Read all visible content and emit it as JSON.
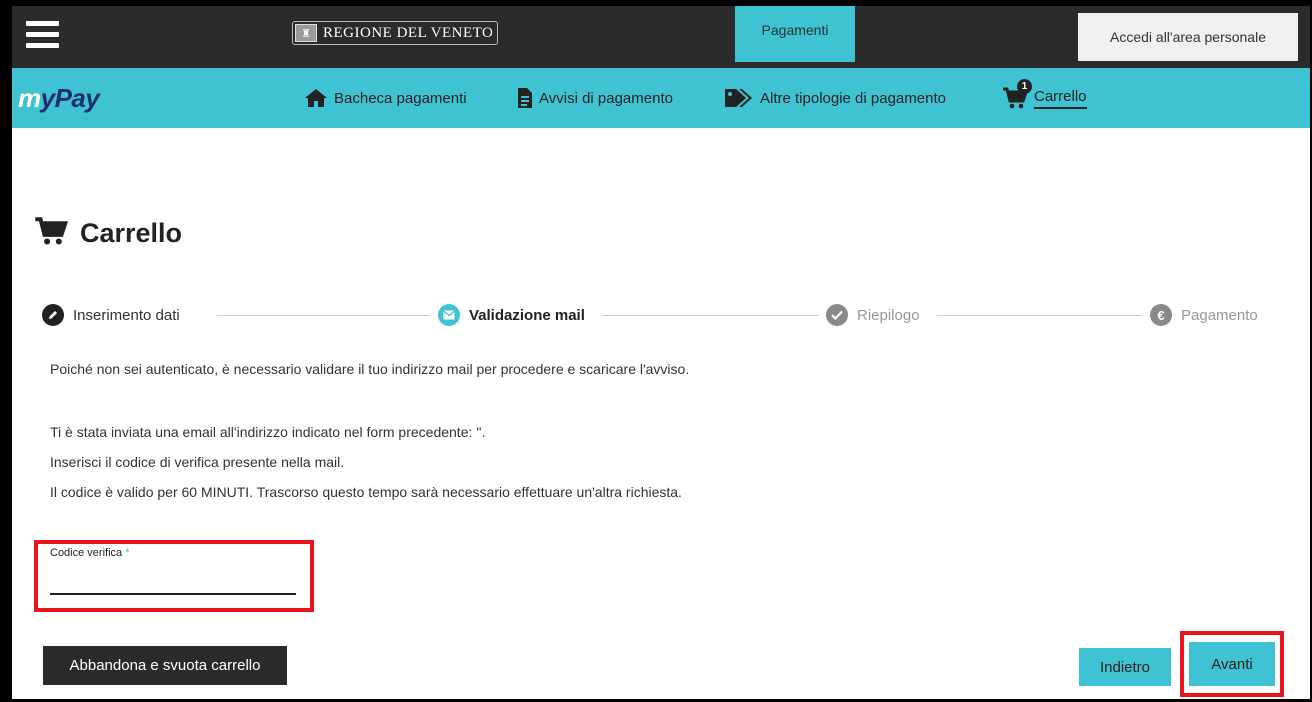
{
  "header": {
    "region_logo_text": "REGIONE DEL VENETO",
    "tab_pagamenti": "Pagamenti",
    "login_button": "Accedi all'area personale"
  },
  "nav": {
    "logo": "myPay",
    "items": [
      {
        "label": "Bacheca pagamenti",
        "icon": "home-icon"
      },
      {
        "label": "Avvisi di pagamento",
        "icon": "document-icon"
      },
      {
        "label": "Altre tipologie di pagamento",
        "icon": "tags-icon"
      },
      {
        "label": "Carrello",
        "icon": "cart-icon",
        "badge": "1",
        "active": true
      }
    ]
  },
  "page": {
    "title": "Carrello"
  },
  "stepper": {
    "steps": [
      {
        "label": "Inserimento dati",
        "icon": "pencil-icon",
        "state": "done"
      },
      {
        "label": "Validazione mail",
        "icon": "envelope-icon",
        "state": "active"
      },
      {
        "label": "Riepilogo",
        "icon": "check-icon",
        "state": "pending"
      },
      {
        "label": "Pagamento",
        "icon": "euro-icon",
        "state": "pending"
      }
    ]
  },
  "content": {
    "intro": "Poiché non sei autenticato, è necessario validare il tuo indirizzo mail per procedere e scaricare l'avviso.",
    "line1": "Ti è stata inviata una email all'indirizzo indicato nel form precedente: ''.",
    "line2": "Inserisci il codice di verifica presente nella mail.",
    "line3": "Il codice è valido per 60 MINUTI. Trascorso questo tempo sarà necessario effettuare un'altra richiesta."
  },
  "form": {
    "code_label": "Codice verifica",
    "required_mark": "*",
    "code_value": ""
  },
  "actions": {
    "abandon": "Abbandona e svuota carrello",
    "back": "Indietro",
    "next": "Avanti"
  },
  "colors": {
    "accent": "#3fc3d2",
    "dark": "#2b2b2b",
    "highlight": "#e8141b",
    "pending": "#9a9a9a"
  }
}
